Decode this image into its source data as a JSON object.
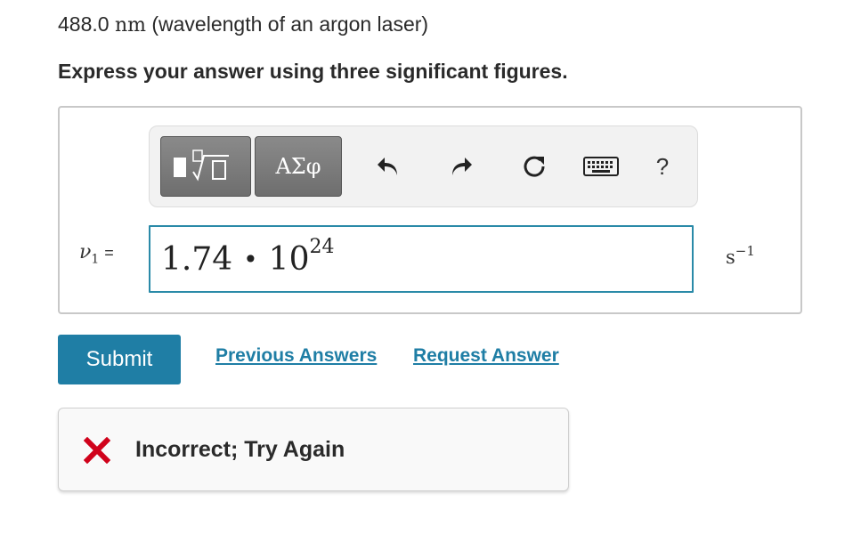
{
  "question": {
    "value": "488.0",
    "unit": "nm",
    "description": "(wavelength of an argon laser)"
  },
  "instruction": "Express your answer using three significant figures.",
  "toolbar": {
    "greek_label": "ΑΣφ",
    "help_label": "?"
  },
  "answer": {
    "variable": "ν",
    "variable_subscript": "1",
    "equals": "=",
    "mantissa": "1.74",
    "operator": "•",
    "base": "10",
    "exponent": "24",
    "unit_base": "s",
    "unit_exponent": "−1"
  },
  "actions": {
    "submit_label": "Submit",
    "previous_answers_label": "Previous Answers",
    "request_answer_label": "Request Answer"
  },
  "feedback": {
    "message": "Incorrect; Try Again",
    "color": "#d0021b"
  },
  "colors": {
    "accent": "#1f7ea5",
    "input_border": "#2a8aa8"
  }
}
